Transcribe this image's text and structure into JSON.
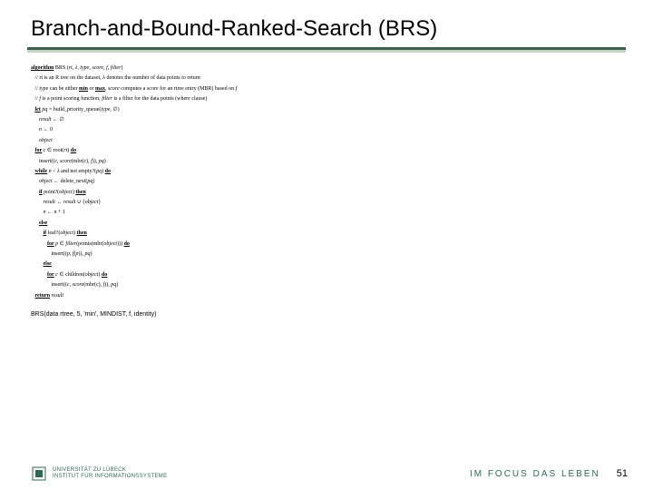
{
  "title": "Branch-and-Bound-Ranked-Search (BRS)",
  "alg": {
    "l0": "algorithm BRS (rt, λ, type, score, f, filter)",
    "l1": "// rt is an R tree on the dataset, λ denotes the number of data points to return",
    "l2": "// type can be either min or max, score computes a score for an rtree entry (MBR) based on f",
    "l3": "// f is a point scoring function, filter is a filter for the data points (where clause)",
    "l4": "let pq = build_priority_queue(type, ∅)",
    "l5": "result ← ∅",
    "l6": "n ← 0",
    "l7": "object",
    "l8": "for c ∈ root(rt) do",
    "l9": "insert((c, score(mbr(c), f)), pq)",
    "l10": "while n < λ and not empty?(pq) do",
    "l11": "object ← delete_next(pq)",
    "l12": "if point?(object) then",
    "l13": "result ← result ∪ {object}",
    "l14": "n ← n + 1",
    "l15": "else",
    "l16": "if leaf?(object) then",
    "l17": "for p ∈ filter(points(mbr(object))) do",
    "l18": "insert((p, f(p)), pq)",
    "l19": "else",
    "l20": "for c ∈ children(object) do",
    "l21": "insert((c, score(mbr(c), f)), pq)",
    "l22": "return result"
  },
  "call": "BRS(data rtree, 5, 'min', MINDIST, f, identity)",
  "footer": {
    "uni_line1": "UNIVERSITÄT ZU LÜBECK",
    "uni_line2": "INSTITUT FÜR INFORMATIONSSYSTEME",
    "tagline": "IM FOCUS DAS LEBEN",
    "page": "51"
  }
}
